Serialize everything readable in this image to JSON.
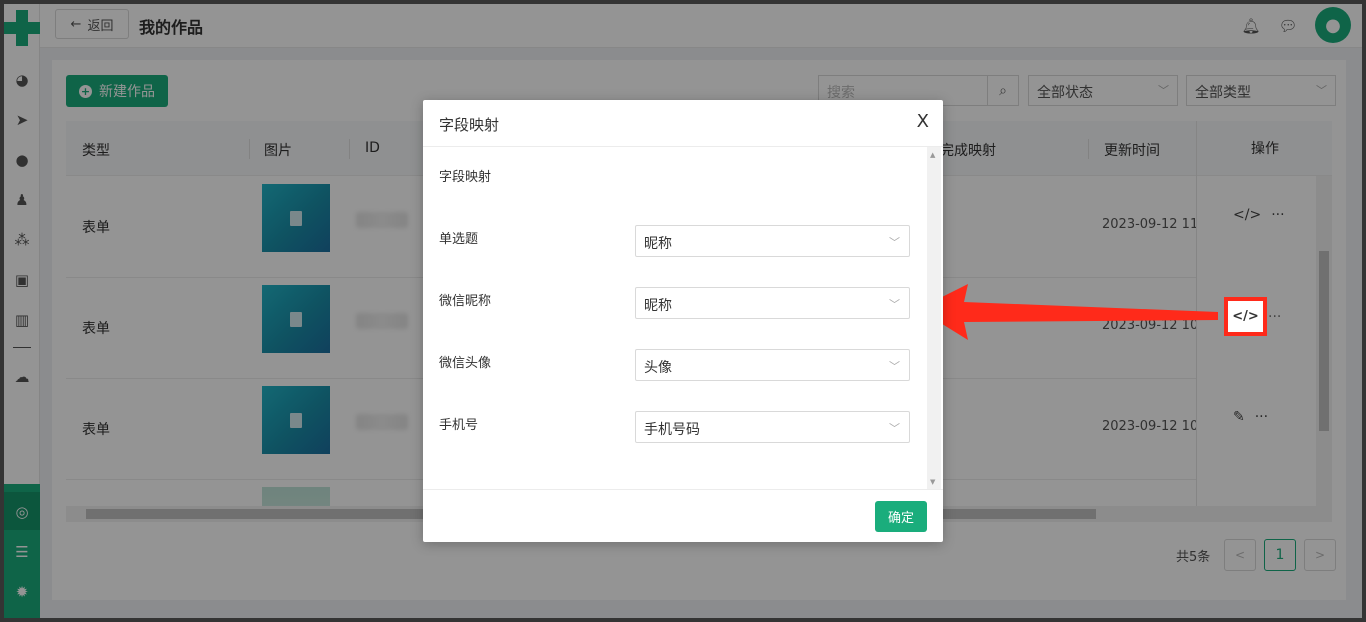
{
  "header": {
    "back_label": "返回",
    "back_icon": "arrow-left-icon",
    "title": "我的作品",
    "icons": [
      "bell-icon",
      "chat-icon",
      "user-avatar-icon"
    ]
  },
  "sidebar": {
    "icons": [
      "dashboard-icon",
      "send-icon",
      "user-icon",
      "users-icon",
      "group-icon",
      "bookmark-icon",
      "bar-chart-icon",
      "wechat-icon"
    ],
    "bottom_icons": [
      "app-icon",
      "server-icon",
      "settings-icon"
    ]
  },
  "toolbar": {
    "new_label": "新建作品",
    "search_placeholder": "搜索",
    "status_select": "全部状态",
    "type_select": "全部类型"
  },
  "table": {
    "columns": [
      "类型",
      "图片",
      "ID",
      "已完成映射",
      "更新时间",
      "操作"
    ],
    "rows": [
      {
        "type": "表单",
        "time": "2023-09-12 11:",
        "ops": "</>"
      },
      {
        "type": "表单",
        "time": "2023-09-12 10:",
        "ops": "</>"
      },
      {
        "type": "表单",
        "time": "2023-09-12 10:",
        "ops": "edit"
      }
    ],
    "more": "···"
  },
  "pagination": {
    "total": "共5条",
    "current": "1",
    "prev": "<",
    "next": ">"
  },
  "modal": {
    "title": "字段映射",
    "close": "X",
    "section": "字段映射",
    "fields": [
      {
        "label": "单选题",
        "value": "昵称"
      },
      {
        "label": "微信昵称",
        "value": "昵称"
      },
      {
        "label": "微信头像",
        "value": "头像"
      },
      {
        "label": "手机号",
        "value": "手机号码"
      }
    ],
    "confirm": "确定"
  },
  "colors": {
    "brand": "#1aad7c",
    "annotation": "#ff2a1a"
  }
}
